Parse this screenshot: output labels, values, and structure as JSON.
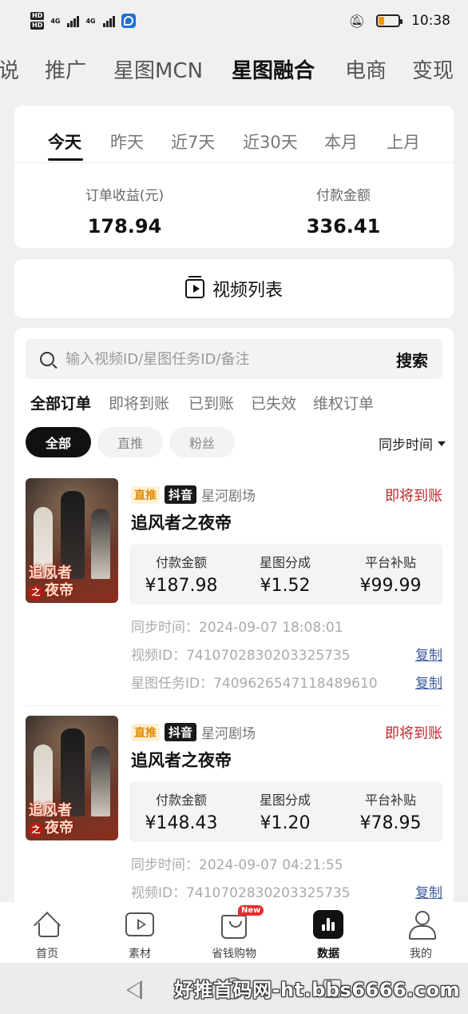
{
  "status_bar": {
    "time": "10:38",
    "hd1": "HD",
    "hd2": "HD",
    "net1": "4G",
    "net2": "4G"
  },
  "top_tabs": [
    "说",
    "推广",
    "星图MCN",
    "星图融合",
    "电商",
    "变现"
  ],
  "top_tabs_active": "星图融合",
  "summary": {
    "ranges": [
      "今天",
      "昨天",
      "近7天",
      "近30天",
      "本月",
      "上月"
    ],
    "active_range": "今天",
    "order_income_label": "订单收益(元)",
    "order_income_value": "178.94",
    "payment_label": "付款金额",
    "payment_value": "336.41"
  },
  "video_list": {
    "label": "视频列表",
    "icon": "video-list-icon"
  },
  "search": {
    "placeholder": "输入视频ID/星图任务ID/备注",
    "button": "搜索"
  },
  "status_tabs": [
    "全部订单",
    "即将到账",
    "已到账",
    "已失效",
    "维权订单"
  ],
  "filter_chips": [
    "全部",
    "直推",
    "粉丝"
  ],
  "sort_label": "同步时间",
  "orders": [
    {
      "tag_type": "直推",
      "platform": "抖音",
      "source": "星河剧场",
      "status": "即将到账",
      "title": "追风者之夜帝",
      "cover_text_top": "追风者",
      "cover_text_mid": "之",
      "cover_text_bottom": "夜帝",
      "pay_label": "付款金额",
      "pay_value": "¥187.98",
      "share_label": "星图分成",
      "share_value": "¥1.52",
      "subsidy_label": "平台补贴",
      "subsidy_value": "¥99.99",
      "sync_time": "同步时间：2024-09-07 18:08:01",
      "video_id": "视频ID：7410702830203325735",
      "task_id": "星图任务ID：7409626547118489610",
      "copy_label": "复制"
    },
    {
      "tag_type": "直推",
      "platform": "抖音",
      "source": "星河剧场",
      "status": "即将到账",
      "title": "追风者之夜帝",
      "cover_text_top": "追风者",
      "cover_text_mid": "之",
      "cover_text_bottom": "夜帝",
      "pay_label": "付款金额",
      "pay_value": "¥148.43",
      "share_label": "星图分成",
      "share_value": "¥1.20",
      "subsidy_label": "平台补贴",
      "subsidy_value": "¥78.95",
      "sync_time": "同步时间：2024-09-07 04:21:55",
      "video_id": "视频ID：7410702830203325735",
      "copy_label": "复制"
    }
  ],
  "bottom_nav": [
    {
      "label": "首页",
      "icon": "home-icon"
    },
    {
      "label": "素材",
      "icon": "play-box-icon"
    },
    {
      "label": "省钱购物",
      "icon": "bag-icon",
      "badge": "New"
    },
    {
      "label": "数据",
      "icon": "chart-icon",
      "active": true
    },
    {
      "label": "我的",
      "icon": "user-icon"
    }
  ],
  "watermark": "好推首码网-ht.bbs6666.com",
  "colors": {
    "status_red": "#c0282d",
    "link_blue": "#3d5b99",
    "direct_tag": "#e08a00",
    "battery": "#f29900",
    "new_badge": "#e62b2b"
  }
}
